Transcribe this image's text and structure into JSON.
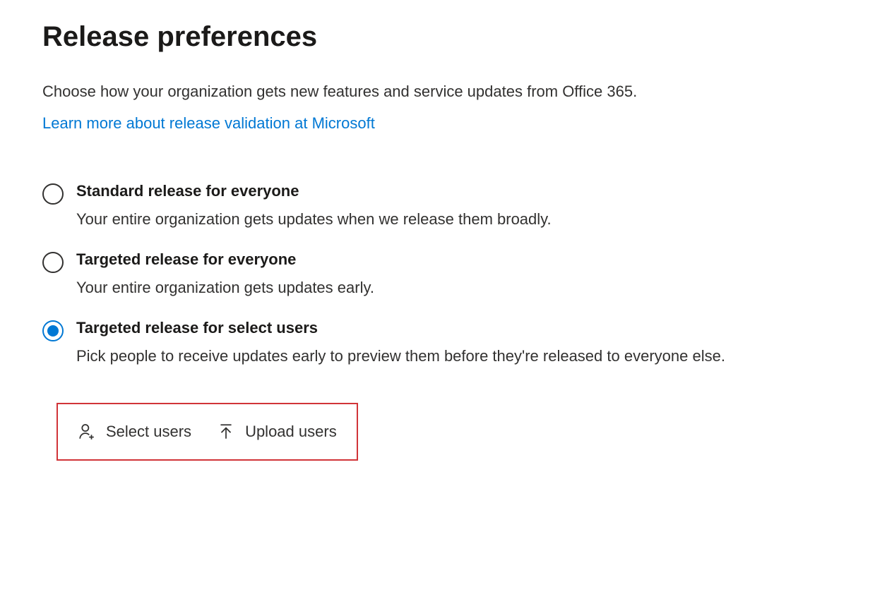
{
  "page": {
    "title": "Release preferences",
    "description": "Choose how your organization gets new features and service updates from Office 365.",
    "learnMoreLink": "Learn more about release validation at Microsoft"
  },
  "options": [
    {
      "label": "Standard release for everyone",
      "description": "Your entire organization gets updates when we release them broadly.",
      "selected": false
    },
    {
      "label": "Targeted release for everyone",
      "description": "Your entire organization gets updates early.",
      "selected": false
    },
    {
      "label": "Targeted release for select users",
      "description": "Pick people to receive updates early to preview them before they're released to everyone else.",
      "selected": true
    }
  ],
  "actions": {
    "selectUsers": "Select users",
    "uploadUsers": "Upload users"
  }
}
